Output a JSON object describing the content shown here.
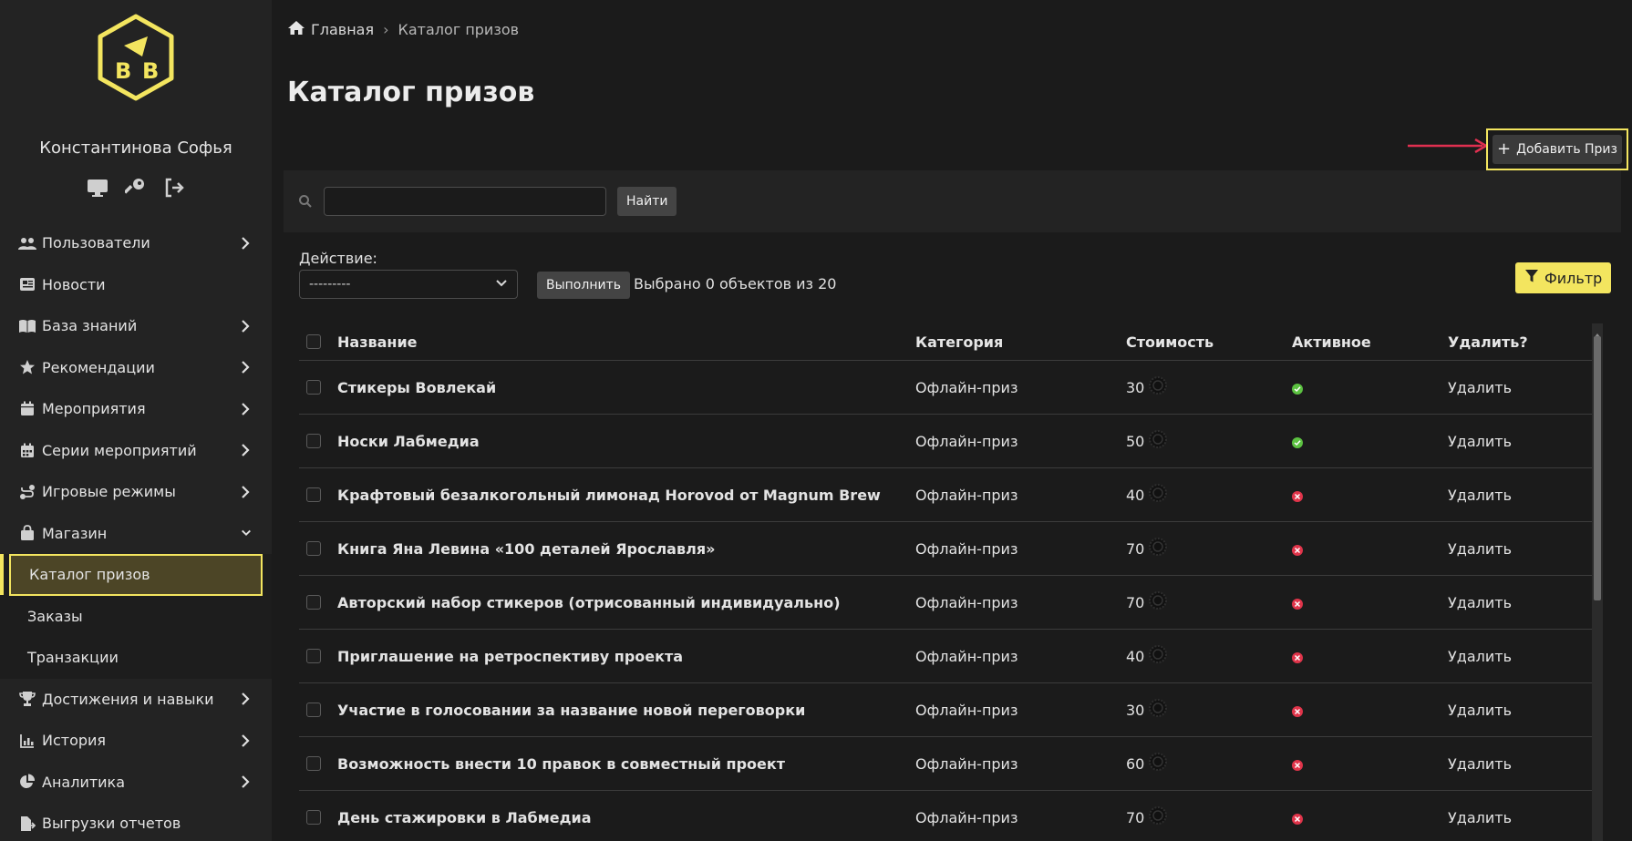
{
  "colors": {
    "accent": "#f3e55f",
    "bg": "#1b1b1b",
    "sidebar": "#232323",
    "active_ok": "#5cc241",
    "inactive": "#e0344a",
    "arrow": "#e03050"
  },
  "sidebar": {
    "user_name": "Константинова Софья",
    "items": [
      {
        "label": "Пользователи",
        "icon": "users-icon",
        "expandable": true
      },
      {
        "label": "Новости",
        "icon": "newspaper-icon",
        "expandable": false
      },
      {
        "label": "База знаний",
        "icon": "book-icon",
        "expandable": true
      },
      {
        "label": "Рекомендации",
        "icon": "star-icon",
        "expandable": true
      },
      {
        "label": "Мероприятия",
        "icon": "calendar-icon",
        "expandable": true
      },
      {
        "label": "Серии мероприятий",
        "icon": "calendar-grid-icon",
        "expandable": true
      },
      {
        "label": "Игровые режимы",
        "icon": "route-icon",
        "expandable": true
      },
      {
        "label": "Магазин",
        "icon": "shopping-bag-icon",
        "expandable": true,
        "expanded": true
      }
    ],
    "shop_sub": [
      {
        "label": "Каталог призов",
        "active": true
      },
      {
        "label": "Заказы"
      },
      {
        "label": "Транзакции"
      }
    ],
    "items_after": [
      {
        "label": "Достижения и навыки",
        "icon": "trophy-icon",
        "expandable": true
      },
      {
        "label": "История",
        "icon": "chart-icon",
        "expandable": true
      },
      {
        "label": "Аналитика",
        "icon": "pie-icon",
        "expandable": true
      },
      {
        "label": "Выгрузки отчетов",
        "icon": "file-export-icon",
        "expandable": false
      }
    ]
  },
  "breadcrumb": {
    "home": "Главная",
    "separator": "›",
    "current": "Каталог  призов"
  },
  "page_title": "Каталог призов",
  "add_button": "Добавить Приз",
  "search": {
    "value": "",
    "button": "Найти"
  },
  "actions": {
    "label": "Действие:",
    "selected": "---------",
    "run": "Выполнить",
    "count": "Выбрано 0 объектов из 20",
    "filter": "Фильтр"
  },
  "table": {
    "headers": {
      "name": "Название",
      "category": "Категория",
      "cost": "Стоимость",
      "active": "Активное",
      "delete": "Удалить?"
    },
    "rows": [
      {
        "name": "Стикеры Вовлекай",
        "category": "Офлайн-приз",
        "cost": "30",
        "active": true,
        "delete": "Удалить"
      },
      {
        "name": "Носки Лабмедиа",
        "category": "Офлайн-приз",
        "cost": "50",
        "active": true,
        "delete": "Удалить"
      },
      {
        "name": "Крафтовый безалкогольный лимонад Horovod от Magnum Brew",
        "category": "Офлайн-приз",
        "cost": "40",
        "active": false,
        "delete": "Удалить"
      },
      {
        "name": "Книга Яна Левина «100 деталей Ярославля»",
        "category": "Офлайн-приз",
        "cost": "70",
        "active": false,
        "delete": "Удалить"
      },
      {
        "name": "Авторский набор стикеров (отрисованный индивидуально)",
        "category": "Офлайн-приз",
        "cost": "70",
        "active": false,
        "delete": "Удалить"
      },
      {
        "name": "Приглашение на ретроспективу проекта",
        "category": "Офлайн-приз",
        "cost": "40",
        "active": false,
        "delete": "Удалить"
      },
      {
        "name": "Участие в голосовании за название новой переговорки",
        "category": "Офлайн-приз",
        "cost": "30",
        "active": false,
        "delete": "Удалить"
      },
      {
        "name": "Возможность внести 10 правок в совместный проект",
        "category": "Офлайн-приз",
        "cost": "60",
        "active": false,
        "delete": "Удалить"
      },
      {
        "name": "День стажировки в Лабмедиа",
        "category": "Офлайн-приз",
        "cost": "70",
        "active": false,
        "delete": "Удалить"
      }
    ]
  }
}
